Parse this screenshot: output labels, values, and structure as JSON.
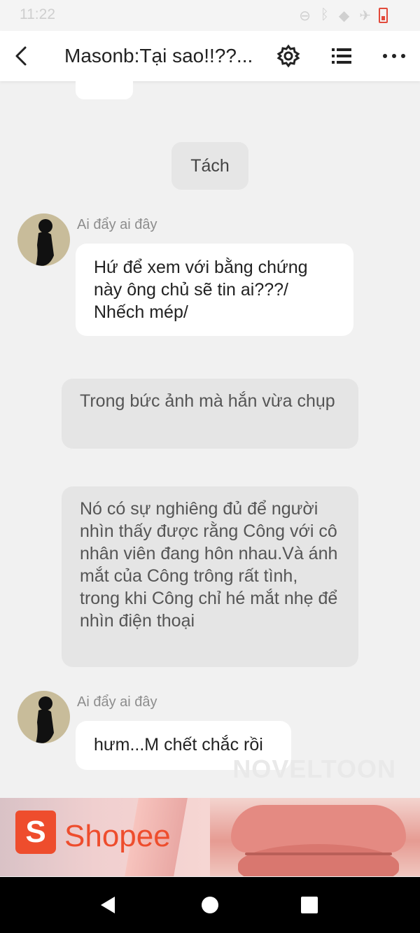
{
  "status_bar": {
    "time": "11:22"
  },
  "header": {
    "title": "Masonb:Tại sao!!??..."
  },
  "chat": {
    "separator": "Tách",
    "messages": [
      {
        "sender": "Ai đẩy ai đây",
        "text": "Hứ để xem với bằng chứng này ông chủ sẽ tin ai???/ Nhếch mép/"
      },
      {
        "sender": "Ai đẩy ai đây",
        "text": "hưm...M chết chắc rồi"
      }
    ],
    "narration": [
      "Trong bức ảnh mà hắn vừa chụp",
      "Nó có sự nghiêng đủ để người nhìn thấy được rằng Công với cô nhân viên đang hôn nhau.Và ánh mắt của Công trông rất tình, trong khi Công chỉ hé mắt nhẹ để nhìn điện thoại"
    ],
    "watermark": "NOVELTOON"
  },
  "ad": {
    "brand": "Shopee",
    "logo_letter": "S"
  },
  "colors": {
    "background": "#f1f1f1",
    "bubble": "#ffffff",
    "narration": "#e5e5e5",
    "brand": "#ee4d2d"
  }
}
